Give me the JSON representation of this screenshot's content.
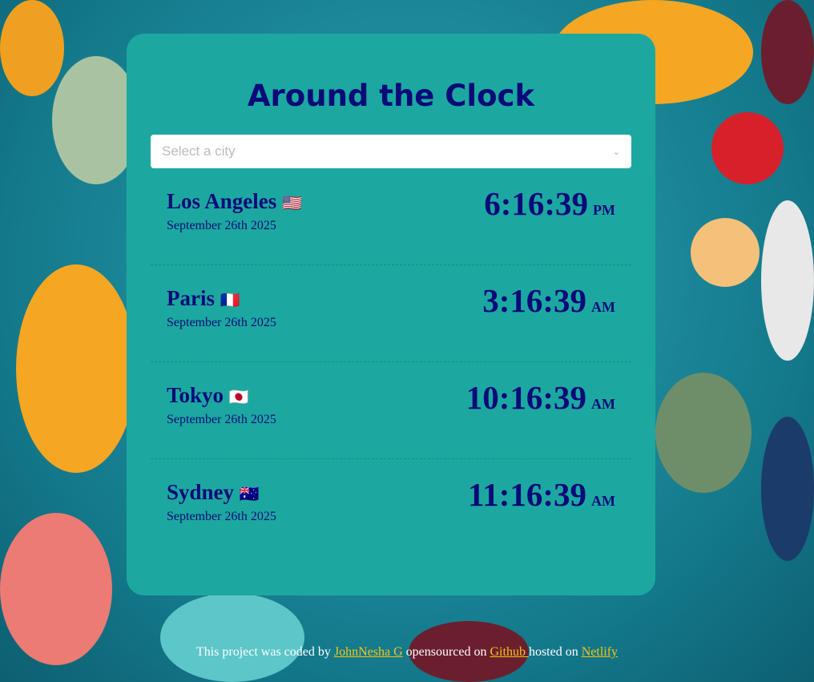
{
  "title": "Around the Clock",
  "select": {
    "placeholder": "Select a city"
  },
  "cities": [
    {
      "name": "Los Angeles",
      "flag": "🇺🇸",
      "date": "September 26th 2025",
      "time": "6:16:39",
      "ampm": "PM"
    },
    {
      "name": "Paris",
      "flag": "🇫🇷",
      "date": "September 26th 2025",
      "time": "3:16:39",
      "ampm": "AM"
    },
    {
      "name": "Tokyo",
      "flag": "🇯🇵",
      "date": "September 26th 2025",
      "time": "10:16:39",
      "ampm": "AM"
    },
    {
      "name": "Sydney",
      "flag": "🇦🇺",
      "date": "September 26th 2025",
      "time": "11:16:39",
      "ampm": "AM"
    }
  ],
  "footer": {
    "t1": "This project was coded by ",
    "author": "JohnNesha G",
    "t2": " opensourced on ",
    "github": "Github ",
    "t3": "hosted on ",
    "netlify": "Netlify"
  },
  "colors": {
    "card": "#1ca8a0",
    "text": "#0a0a7a",
    "link": "#f5c518"
  }
}
